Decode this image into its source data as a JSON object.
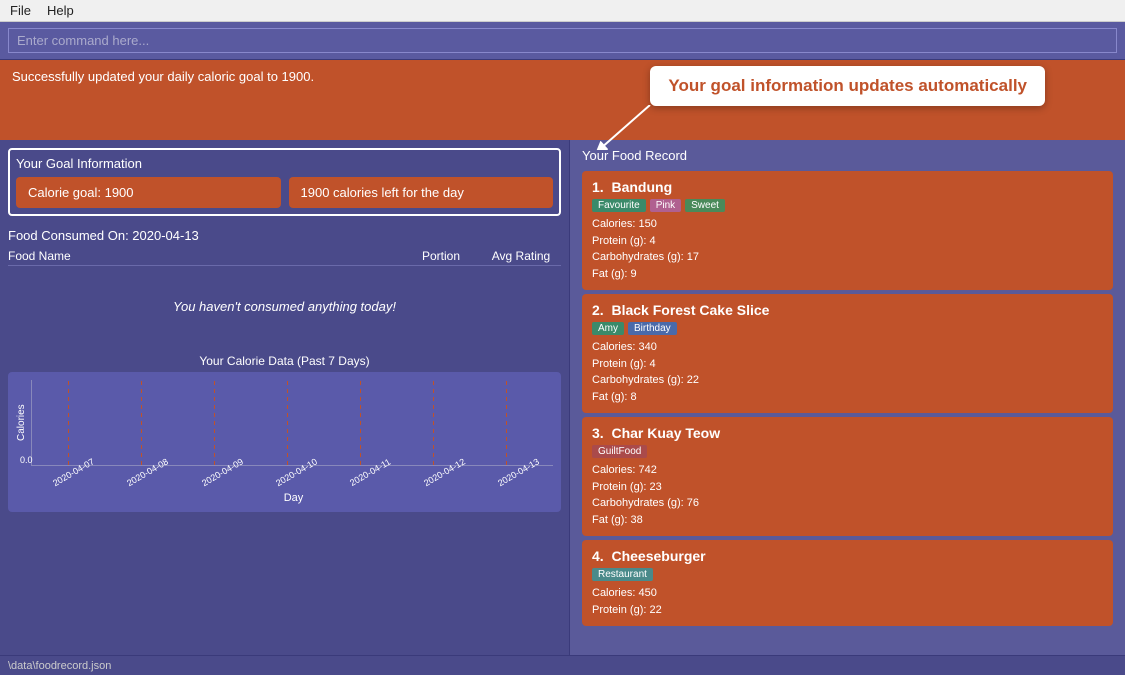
{
  "menubar": {
    "items": [
      "File",
      "Help"
    ]
  },
  "command_bar": {
    "placeholder": "Enter command here..."
  },
  "banner": {
    "message": "Successfully updated your daily caloric goal to 1900.",
    "callout": "Your goal information updates automatically"
  },
  "goal": {
    "title": "Your Goal Information",
    "calorie_goal_label": "Calorie goal: 1900",
    "calories_left_label": "1900 calories left for the day"
  },
  "consumed": {
    "title": "Food Consumed On: 2020-04-13",
    "columns": {
      "name": "Food Name",
      "portion": "Portion",
      "rating": "Avg Rating"
    },
    "empty_message": "You haven't consumed anything today!"
  },
  "chart": {
    "title": "Your Calorie Data (Past 7 Days)",
    "y_label": "Calories",
    "x_label": "Day",
    "zero_label": "0.0",
    "x_dates": [
      "2020-04-07",
      "2020-04-08",
      "2020-04-09",
      "2020-04-10",
      "2020-04-11",
      "2020-04-12",
      "2020-04-13"
    ],
    "dashed_positions": [
      7,
      20,
      33,
      46,
      59,
      73,
      86
    ]
  },
  "food_record": {
    "title": "Your Food Record",
    "items": [
      {
        "number": "1.",
        "name": "Bandung",
        "tags": [
          {
            "label": "Favourite",
            "class": ""
          },
          {
            "label": "Pink",
            "class": "pink"
          },
          {
            "label": "Sweet",
            "class": "sweet"
          }
        ],
        "calories": "Calories: 150",
        "protein": "Protein (g): 4",
        "carbs": "Carbohydrates (g): 17",
        "fat": "Fat (g): 9"
      },
      {
        "number": "2.",
        "name": "Black Forest Cake Slice",
        "tags": [
          {
            "label": "Amy",
            "class": ""
          },
          {
            "label": "Birthday",
            "class": "birthday"
          }
        ],
        "calories": "Calories: 340",
        "protein": "Protein (g): 4",
        "carbs": "Carbohydrates (g): 22",
        "fat": "Fat (g): 8"
      },
      {
        "number": "3.",
        "name": "Char Kuay Teow",
        "tags": [
          {
            "label": "GuiltFood",
            "class": "guiltfood"
          }
        ],
        "calories": "Calories: 742",
        "protein": "Protein (g): 23",
        "carbs": "Carbohydrates (g): 76",
        "fat": "Fat (g): 38"
      },
      {
        "number": "4.",
        "name": "Cheeseburger",
        "tags": [
          {
            "label": "Restaurant",
            "class": "restaurant"
          }
        ],
        "calories": "Calories: 450",
        "protein": "Protein (g): 22",
        "carbs": "",
        "fat": ""
      }
    ]
  },
  "statusbar": {
    "text": "\\data\\foodrecord.json"
  }
}
